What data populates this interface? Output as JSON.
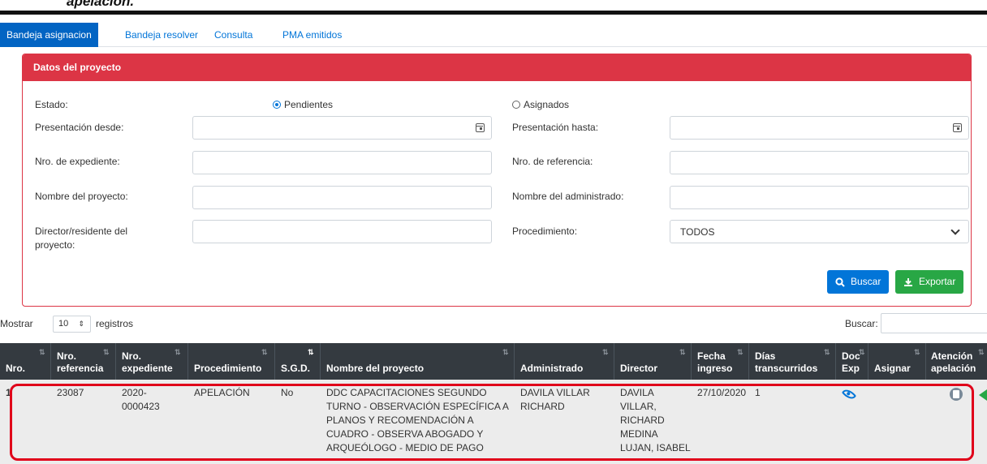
{
  "heading": "apelación.",
  "tabs": [
    "Bandeja asignacion",
    "Bandeja resolver",
    "Consulta",
    "PMA emitidos"
  ],
  "card": {
    "title": "Datos del proyecto",
    "estado_label": "Estado:",
    "radio_pendientes": "Pendientes",
    "radio_asignados": "Asignados",
    "presentacion_desde": "Presentación desde:",
    "presentacion_hasta": "Presentación hasta:",
    "nro_expediente": "Nro. de expediente:",
    "nro_referencia": "Nro. de referencia:",
    "nombre_proyecto": "Nombre del proyecto:",
    "nombre_administrado": "Nombre del administrado:",
    "director_line1": "Director/residente del",
    "director_line2": "proyecto:",
    "procedimiento": "Procedimiento:",
    "procedimiento_value": "TODOS",
    "buscar_btn": "Buscar",
    "exportar_btn": "Exportar"
  },
  "list": {
    "mostrar": "Mostrar",
    "length_value": "10",
    "registros": "registros",
    "buscar_label": "Buscar:"
  },
  "table": {
    "headers": [
      [
        "Nro.",
        ""
      ],
      [
        "Nro.",
        "referencia"
      ],
      [
        "Nro.",
        "expediente"
      ],
      [
        "Procedimiento",
        ""
      ],
      [
        "S.G.D.",
        ""
      ],
      [
        "Nombre del proyecto",
        ""
      ],
      [
        "Administrado",
        ""
      ],
      [
        "Director",
        ""
      ],
      [
        "Fecha",
        "ingreso"
      ],
      [
        "Días",
        "transcurridos"
      ],
      [
        "Doc",
        "Exp"
      ],
      [
        "Asignar",
        ""
      ],
      [
        "Atención",
        "apelación"
      ]
    ],
    "row": {
      "nro": "1",
      "referencia": "23087",
      "expediente_1": "2020-",
      "expediente_2": "0000423",
      "procedimiento": "APELACIÓN",
      "sgd": "No",
      "proyecto_1": "DDC CAPACITACIONES SEGUNDO",
      "proyecto_2": "TURNO - OBSERVACIÓN ESPECÍFICA A",
      "proyecto_3": "PLANOS Y RECOMENDACIÓN A",
      "proyecto_4": "CUADRO - OBSERVA ABOGADO Y",
      "proyecto_5": "ARQUEÓLOGO - MEDIO DE PAGO",
      "administrado_1": "DAVILA VILLAR",
      "administrado_2": "RICHARD",
      "director_1": "DAVILA",
      "director_2": "VILLAR,",
      "director_3": "RICHARD",
      "director_4": "MEDINA",
      "director_5": "LUJAN, ISABEL",
      "fecha": "27/10/2020",
      "dias": "1"
    }
  },
  "colors": {
    "primary": "#0275d8",
    "danger": "#dc3545",
    "success": "#28a745",
    "table_head": "#343a40"
  }
}
